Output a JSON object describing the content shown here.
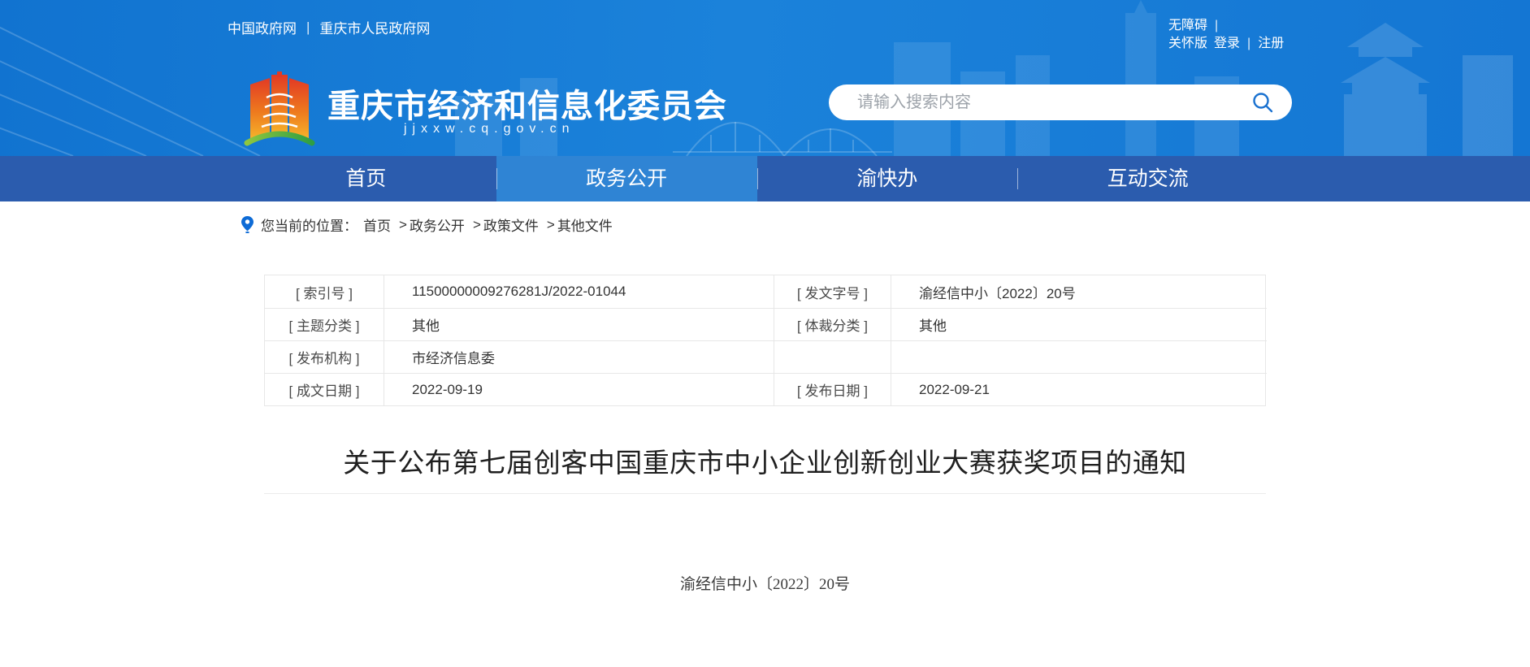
{
  "colors": {
    "header_blue": "#1478d4",
    "nav_blue": "#2b5cae",
    "nav_active_blue": "#2f84d4",
    "search_icon_blue": "#1b72d0",
    "pin_blue": "#0e6bd6",
    "table_border": "#e7e7e7",
    "text_dark": "#333333"
  },
  "topbar": {
    "separator": "|",
    "left_links": [
      "中国政府网",
      "重庆市人民政府网"
    ],
    "accessibility": "无障碍",
    "care_version": "关怀版",
    "login": "登录",
    "register": "注册"
  },
  "header": {
    "site_name": "重庆市经济和信息化委员会",
    "site_url": "jjxxw.cq.gov.cn",
    "search_placeholder": "请输入搜索内容"
  },
  "nav": {
    "items": [
      {
        "id": "home",
        "label": "首页",
        "active": false
      },
      {
        "id": "gov-info",
        "label": "政务公开",
        "active": true
      },
      {
        "id": "yukuaiban",
        "label": "渝快办",
        "active": false
      },
      {
        "id": "interaction",
        "label": "互动交流",
        "active": false
      }
    ]
  },
  "breadcrumb": {
    "label": "您当前的位置：",
    "separator": ">",
    "items": [
      "首页",
      "政务公开",
      "政策文件",
      "其他文件"
    ]
  },
  "meta_table": {
    "rows": [
      [
        "[ 索引号 ]",
        "11500000009276281J/2022-01044",
        "[ 发文字号 ]",
        "渝经信中小〔2022〕20号"
      ],
      [
        "[ 主题分类 ]",
        "其他",
        "[ 体裁分类 ]",
        "其他"
      ],
      [
        "[ 发布机构 ]",
        "市经济信息委",
        "",
        ""
      ],
      [
        "[ 成文日期 ]",
        "2022-09-19",
        "[ 发布日期 ]",
        "2022-09-21"
      ]
    ]
  },
  "article": {
    "title": "关于公布第七届创客中国重庆市中小企业创新创业大赛获奖项目的通知",
    "doc_number": "渝经信中小〔2022〕20号"
  }
}
